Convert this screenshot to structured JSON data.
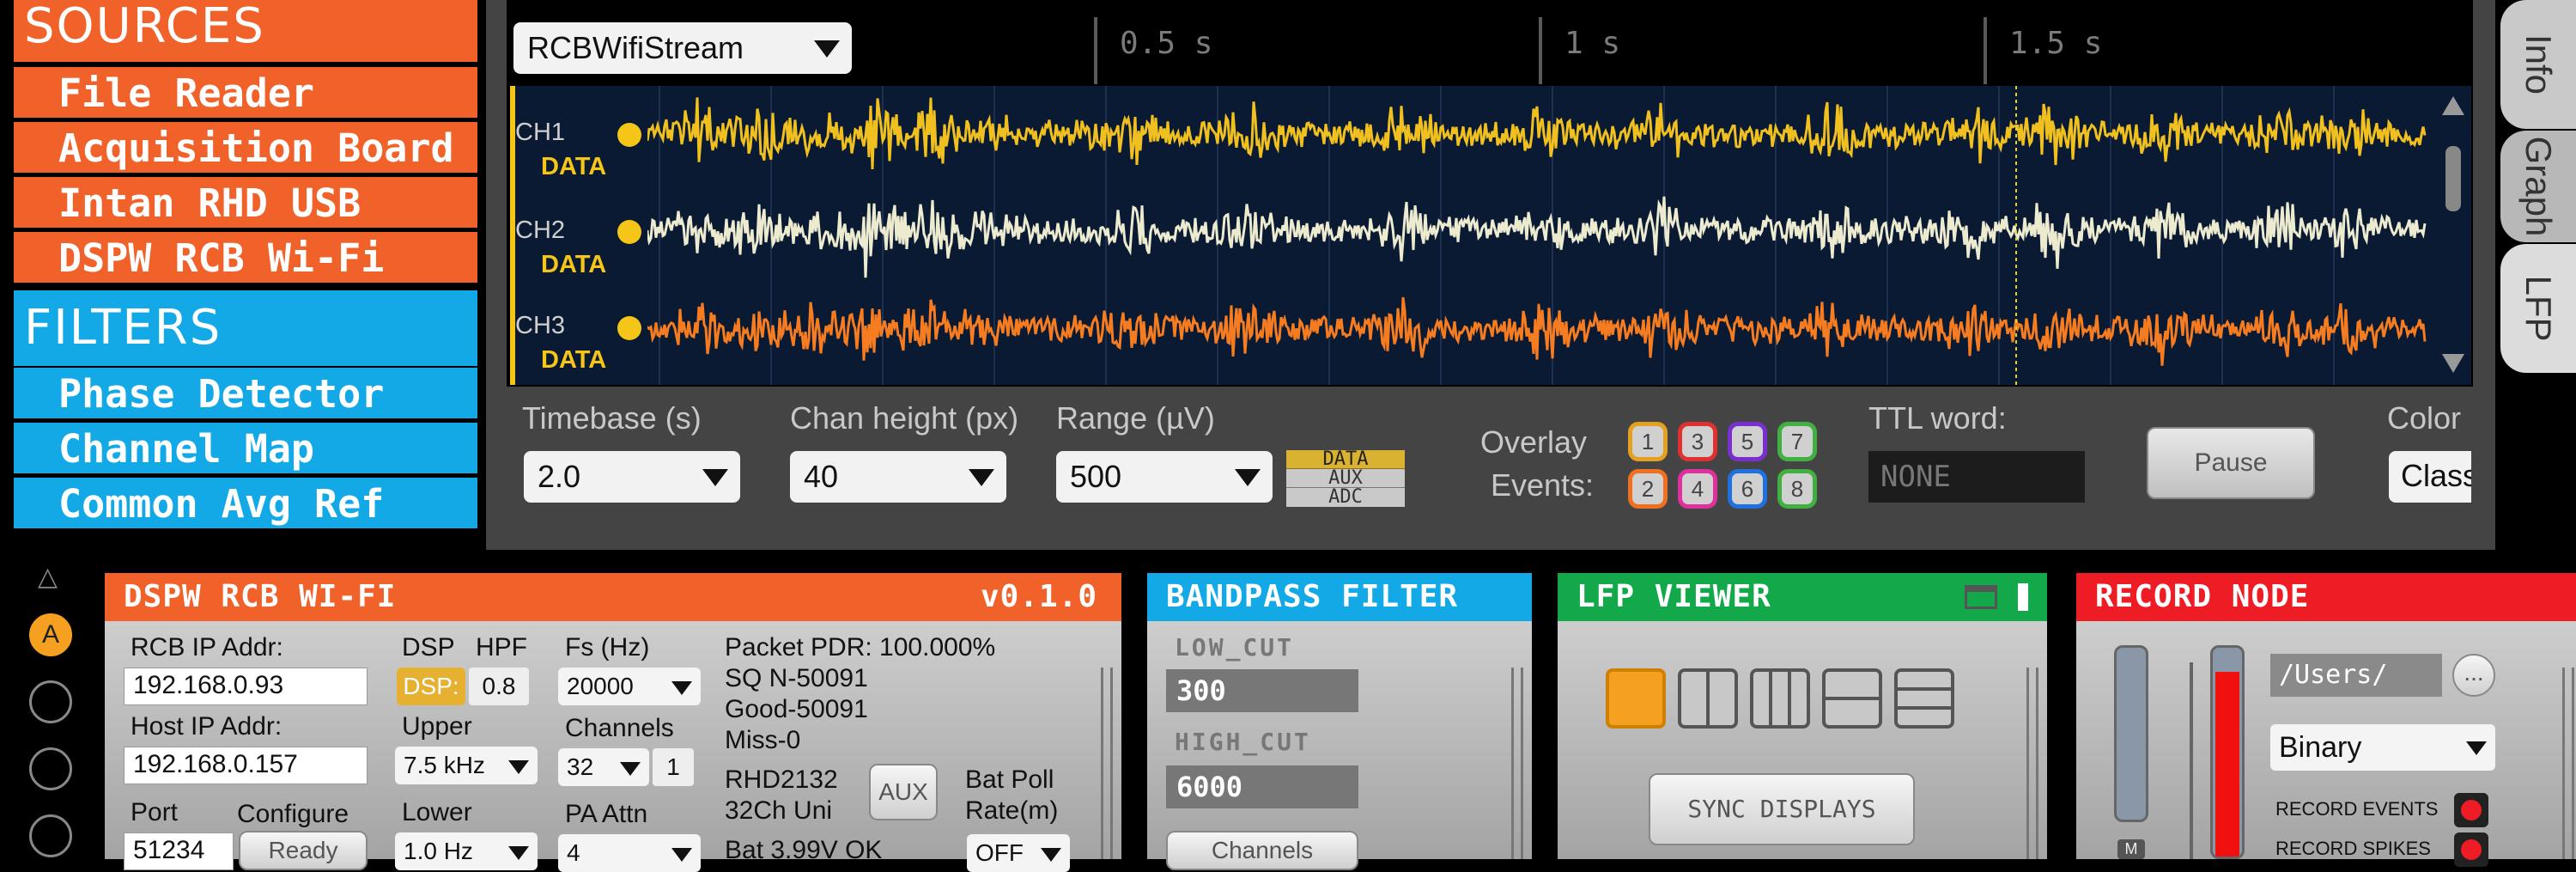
{
  "sources": {
    "title": "SOURCES",
    "items": [
      "File Reader",
      "Acquisition Board",
      "Intan RHD USB",
      "DSPW RCB Wi-Fi"
    ]
  },
  "filters": {
    "title": "FILTERS",
    "items": [
      "Phase Detector",
      "Channel Map",
      "Common Avg Ref"
    ]
  },
  "lfp": {
    "stream": "RCBWifiStream",
    "time_ticks": [
      "0.5 s",
      "1 s",
      "1.5 s"
    ],
    "channels": [
      {
        "name": "CH1",
        "type": "DATA",
        "color": "#f0c020"
      },
      {
        "name": "CH2",
        "type": "DATA",
        "color": "#ecebd0"
      },
      {
        "name": "CH3",
        "type": "DATA",
        "color": "#f57c20"
      }
    ],
    "controls": {
      "timebase_label": "Timebase (s)",
      "timebase_value": "2.0",
      "chan_height_label": "Chan height (px)",
      "chan_height_value": "40",
      "range_label": "Range (µV)",
      "range_value": "500",
      "type_buttons": [
        "DATA",
        "AUX",
        "ADC"
      ],
      "overlay_label_1": "Overlay",
      "overlay_label_2": "Events:",
      "events_top": [
        "1",
        "3",
        "5",
        "7"
      ],
      "events_bottom": [
        "2",
        "4",
        "6",
        "8"
      ],
      "ttl_label": "TTL word:",
      "ttl_value": "NONE",
      "pause_label": "Pause",
      "color_label": "Color",
      "color_value": "Classic"
    }
  },
  "tabs": [
    "Info",
    "Graph",
    "LFP"
  ],
  "signal_chain": {
    "collapse_icon": "△",
    "a_label": "A"
  },
  "dspw": {
    "title": "DSPW RCB WI-FI",
    "version": "v0.1.0",
    "rcb_ip_label": "RCB IP Addr:",
    "rcb_ip": "192.168.0.93",
    "host_ip_label": "Host IP Addr:",
    "host_ip": "192.168.0.157",
    "port_label": "Port",
    "port": "51234",
    "configure_label": "Configure",
    "ready_label": "Ready",
    "dsp_label": "DSP",
    "hpf_label": "HPF",
    "dsp_button": "DSP:",
    "hpf_value": "0.8",
    "upper_label": "Upper",
    "upper_value": "7.5 kHz",
    "lower_label": "Lower",
    "lower_value": "1.0 Hz",
    "fs_label": "Fs (Hz)",
    "fs_value": "20000",
    "channels_label": "Channels",
    "channels_value": "32",
    "channels_extra": "1",
    "pa_label": "PA Attn",
    "pa_value": "4",
    "packet_pdr": "Packet PDR: 100.000%",
    "sq": "SQ N-50091",
    "good": "Good-50091",
    "miss": "Miss-0",
    "chip": "RHD2132",
    "chip2": "32Ch Uni",
    "aux_label": "AUX",
    "bat_poll_label": "Bat Poll",
    "bat_rate_label": "Rate(m)",
    "bat_poll_value": "OFF",
    "battery": "Bat 3.99V OK"
  },
  "bandpass": {
    "title": "BANDPASS FILTER",
    "low_label": "LOW_CUT",
    "low_value": "300",
    "high_label": "HIGH_CUT",
    "high_value": "6000",
    "channels_btn": "Channels"
  },
  "lfp_viewer": {
    "title": "LFP VIEWER",
    "sync_label": "SYNC DISPLAYS"
  },
  "record": {
    "title": "RECORD NODE",
    "path": "/Users/",
    "browse": "...",
    "format": "Binary",
    "events_label": "RECORD EVENTS",
    "spikes_label": "RECORD SPIKES",
    "m_label": "M"
  },
  "colors": {
    "source": "#f0622a",
    "filter": "#12a9e6",
    "sink": "#13a94a",
    "record": "#ee1c24"
  }
}
